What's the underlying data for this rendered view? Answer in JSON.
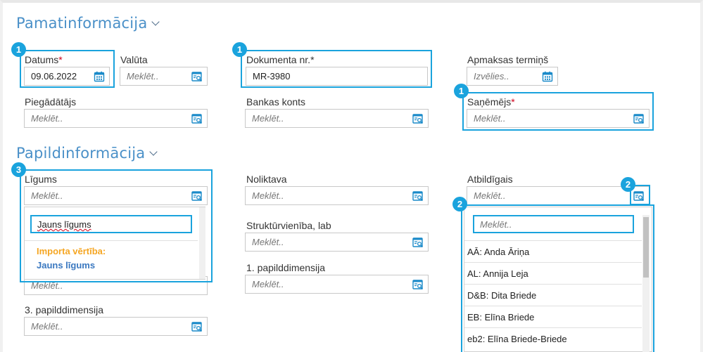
{
  "sections": {
    "basic": "Pamatinformācija",
    "additional": "Papildinformācija"
  },
  "fields": {
    "datums": {
      "label": "Datums",
      "required": "*",
      "value": "09.06.2022"
    },
    "valuta": {
      "label": "Valūta",
      "placeholder": "Meklēt.."
    },
    "dokumenta_nr": {
      "label": "Dokumenta nr.",
      "required": "*",
      "value": "MR-3980"
    },
    "apmaksas_termins": {
      "label": "Apmaksas termiņš",
      "placeholder": "Izvēlies.."
    },
    "piegadatajs": {
      "label": "Piegādātājs",
      "placeholder": "Meklēt.."
    },
    "bankas_konts": {
      "label": "Bankas konts",
      "placeholder": "Meklēt.."
    },
    "sanemejs": {
      "label": "Saņēmējs",
      "required": "*",
      "placeholder": "Meklēt.."
    },
    "ligums": {
      "label": "Līgums",
      "placeholder": "Meklēt.."
    },
    "noliktava": {
      "label": "Noliktava",
      "placeholder": "Meklēt.."
    },
    "atbildigais": {
      "label": "Atbildīgais",
      "placeholder": "Meklēt.."
    },
    "strukturvieniba": {
      "label": "Struktūrvienība, lab",
      "placeholder": "Meklēt.."
    },
    "papilddim1": {
      "label": "1. papilddimensija",
      "placeholder": "Meklēt.."
    },
    "papilddim2": {
      "placeholder": "Meklēt.."
    },
    "papilddim3": {
      "label": "3. papilddimensija",
      "placeholder": "Meklēt.."
    }
  },
  "ligums_dropdown": {
    "search_value": "Jauns līgums",
    "import_label": "Importa vērtība:",
    "import_value": "Jauns līgums"
  },
  "atbildigais_dropdown": {
    "search_placeholder": "Meklēt..",
    "items": [
      "AĀ: Anda Āriņa",
      "AL: Annija Leja",
      "D&B: Dita Briede",
      "EB: Elīna Briede",
      "eb2: Elīna Briede-Briede"
    ]
  },
  "badges": {
    "one": "1",
    "two": "2",
    "three": "3"
  },
  "colors": {
    "accent": "#1aa3dd",
    "title": "#4a90c8",
    "required": "#d0021b",
    "import_label": "#f5a623",
    "import_value": "#3a78c0"
  }
}
